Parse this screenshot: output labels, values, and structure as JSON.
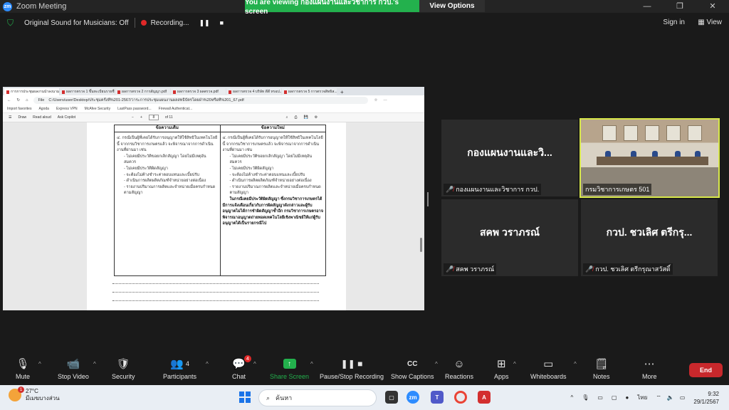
{
  "app": {
    "title": "Zoom Meeting",
    "logo": "zm",
    "share_banner": "You are viewing กองแผนงานและวิชาการ กวป.'s screen",
    "view_options": "View Options",
    "window_controls": [
      "—",
      "❐",
      "✕"
    ]
  },
  "status": {
    "original_sound": "Original Sound for Musicians: Off",
    "recording": "Recording...",
    "sign_in": "Sign in",
    "view": "View"
  },
  "browser": {
    "tabs": [
      {
        "label": "การการประชุมผลงานนำลงนามสม..."
      },
      {
        "label": "ผลการตรวจ 1 ขึ้นทะเบียนรายชื่..."
      },
      {
        "label": "ผลการตรวจ 2 การสัญญา.pdf"
      },
      {
        "label": "ผลการตรวจ 3 ผลตรวจ.pdf"
      },
      {
        "label": "ผลการตรวจ 4 บริษัท ดีดี ทรอป..."
      },
      {
        "label": "ผลการตรวจ 5 การตรวจสิทธิส..."
      }
    ],
    "url_prefix": "File",
    "url": "C:/Users/user/Desktop/ประชุมครั้งที่%201-2567/วาระการประชุมแผนงานผลสทธิบัตรโดยฝ่า%20หรือที่%201_67.pdf",
    "favorites": [
      "Import favorites",
      "Agoda",
      "Express VPN",
      "McAfee Security",
      "LastPass password...",
      "Firewall Authenticat..."
    ],
    "pdf_toolbar": {
      "draw": "Draw",
      "read_aloud": "Read aloud",
      "ask_copilot": "Ask Copilot",
      "page": "8",
      "of": "of 11"
    }
  },
  "document": {
    "col_old_header": "ข้อความเดิม",
    "col_new_header": "ข้อความใหม่",
    "old_lines": [
      "๔. กรณีเป็นผู้ที่เคยได้รับการอนุญาตให้ใช้สิทธิในเทคโนโลยีนี้ จากกรมวิชาการเกษตรแล้ว จะพิจารณาจากการดำเนินงานที่ผ่านมา เช่น",
      "- ไม่เคยมีประวัติขอยกเลิกสัญญา โดยไม่มีเหตุอันสมควร",
      "- ไม่เคยมีประวัติผิดสัญญา",
      "- จะต้องไม่ค้างชำระค่าตอบแทนและเบี้ยปรับ",
      "- ดำเนินการผลิตผลิตภัณฑ์จำหน่ายอย่างต่อเนื่อง",
      "- รายงานปริมาณการผลิตและจำหน่ายเมื่อครบกำหนดตามสัญญา"
    ],
    "new_lines": [
      "๔. กรณีเป็นผู้ที่เคยได้รับการอนุญาตให้ใช้สิทธิในเทคโนโลยีนี้ จากกรมวิชาการเกษตรแล้ว จะพิจารณาจากการดำเนินงานที่ผ่านมา เช่น",
      "- ไม่เคยมีประวัติขอยกเลิกสัญญา โดยไม่มีเหตุอันสมควร",
      "- ไม่เคยมีประวัติผิดสัญญา",
      "- จะต้องไม่ค้างชำระค่าตอบแทนและเบี้ยปรับ",
      "- ดำเนินการผลิตผลิตภัณฑ์จำหน่ายอย่างต่อเนื่อง",
      "- รายงานปริมาณการผลิตและจำหน่ายเมื่อครบกำหนดตามสัญญา"
    ],
    "new_bold": "ในกรณีเคยมีประวัติผิดสัญญา ซึ่งกรมวิชาการเกษตรได้มีการแจ้งเตือนเกี่ยวกับการผิดสัญญาดังกล่าวและผู้รับอนุญาตไม่ได้การชำผิดสัญญาซ้ำอีก กรมวิชาการเกษตรอาจพิจารณาอนุญาตถ่ายทอดเทคโนโลยีเชิงพาณิชย์ให้แก่ผู้รับอนุญาตได้เป็นรายกรณีไป"
  },
  "participants": [
    {
      "big_name": "กองแผนงานและวิ...",
      "label": "กองแผนงานและวิชาการ กวป."
    },
    {
      "big_name": "",
      "label": "กรมวิชาการเกษตร 501"
    },
    {
      "big_name": "สคพ  วราภรณ์",
      "label": "สคพ  วราภรณ์"
    },
    {
      "big_name": "กวป. ชวเลิศ ตรีกรุ...",
      "label": "กวป. ชวเลิศ ตรีกรุณาสวัสดิ์"
    }
  ],
  "toolbar": {
    "mute": "Mute",
    "stop_video": "Stop Video",
    "security": "Security",
    "participants": "Participants",
    "participants_count": "4",
    "chat": "Chat",
    "chat_badge": "4",
    "share_screen": "Share Screen",
    "pause_stop_recording": "Pause/Stop Recording",
    "show_captions": "Show Captions",
    "reactions": "Reactions",
    "apps": "Apps",
    "whiteboards": "Whiteboards",
    "notes": "Notes",
    "more": "More",
    "end": "End"
  },
  "taskbar": {
    "temperature": "27°C",
    "weather_desc": "มีเมฆบางส่วน",
    "weather_badge": "1",
    "search_placeholder": "ค้นหา",
    "language": "ไทย",
    "time": "9:32",
    "date": "29/1/2567"
  },
  "colors": {
    "zoom_green": "#23b14d",
    "zoom_blue": "#2d8cff",
    "end_red": "#c8282c",
    "active_speaker": "#d8e84a"
  }
}
